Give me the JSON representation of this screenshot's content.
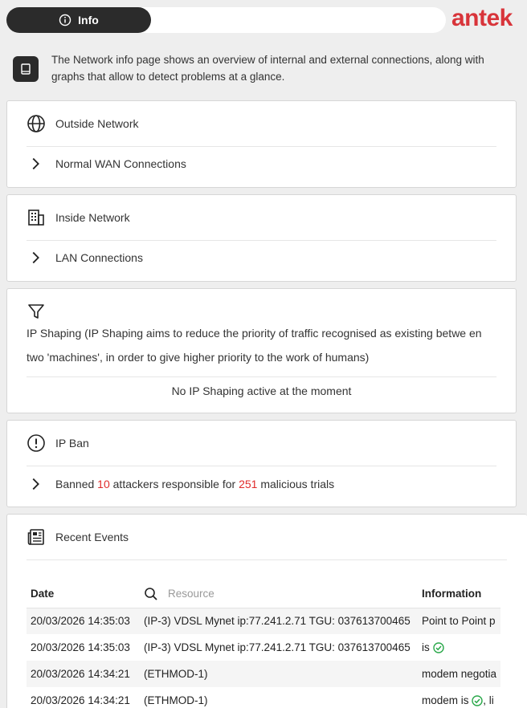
{
  "topbar": {
    "tab_label": "Info"
  },
  "brand": {
    "logo_text": "antek",
    "color": "#d8343a"
  },
  "intro": {
    "text": "The Network info page shows an overview of internal and external connections, along with graphs that allow to detect problems at a glance."
  },
  "outside": {
    "title": "Outside Network",
    "row_label": "Normal WAN Connections"
  },
  "inside": {
    "title": "Inside Network",
    "row_label": "LAN Connections"
  },
  "shaping": {
    "title": "IP Shaping (IP Shaping aims to reduce the priority of traffic recognised as existing betwe en two 'machines', in order to give higher priority to the work of humans)",
    "status": "No IP Shaping active at the moment"
  },
  "ipban": {
    "title": "IP Ban",
    "prefix": "Banned",
    "attackers": "10",
    "middle": "attackers responsible for",
    "trials": "251",
    "suffix": "malicious trials"
  },
  "events": {
    "title": "Recent Events",
    "headers": {
      "date": "Date",
      "resource_placeholder": "Resource",
      "information": "Information"
    },
    "rows": [
      {
        "date": "20/03/2026 14:35:03",
        "resource": "(IP-3) VDSL Mynet ip:77.241.2.71 TGU: 037613700465",
        "info": "Point to Point p"
      },
      {
        "date": "20/03/2026 14:35:03",
        "resource": "(IP-3) VDSL Mynet ip:77.241.2.71 TGU: 037613700465",
        "info": "is"
      },
      {
        "date": "20/03/2026 14:34:21",
        "resource": "(ETHMOD-1)",
        "info": "modem negotia"
      },
      {
        "date": "20/03/2026 14:34:21",
        "resource": "(ETHMOD-1)",
        "info": "modem is",
        "info_tail": ", li"
      }
    ]
  },
  "colors": {
    "accent_red": "#e02b2b",
    "ok_green": "#2aa84a",
    "dark": "#2b2b2b"
  }
}
